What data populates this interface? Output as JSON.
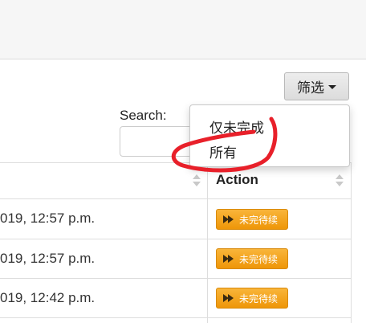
{
  "toolbar": {
    "filter_label": "筛选"
  },
  "search": {
    "label": "Search:",
    "value": ""
  },
  "dropdown": {
    "items": [
      "仅未完成",
      "所有"
    ]
  },
  "table": {
    "action_header": "Action",
    "rows": [
      {
        "date": "019, 12:57 p.m.",
        "action": "未完待续"
      },
      {
        "date": "019, 12:57 p.m.",
        "action": "未完待续"
      },
      {
        "date": "019, 12:42 p.m.",
        "action": "未完待续"
      }
    ]
  },
  "colors": {
    "action_button": "#f0a020",
    "annotation": "#e8202a"
  }
}
